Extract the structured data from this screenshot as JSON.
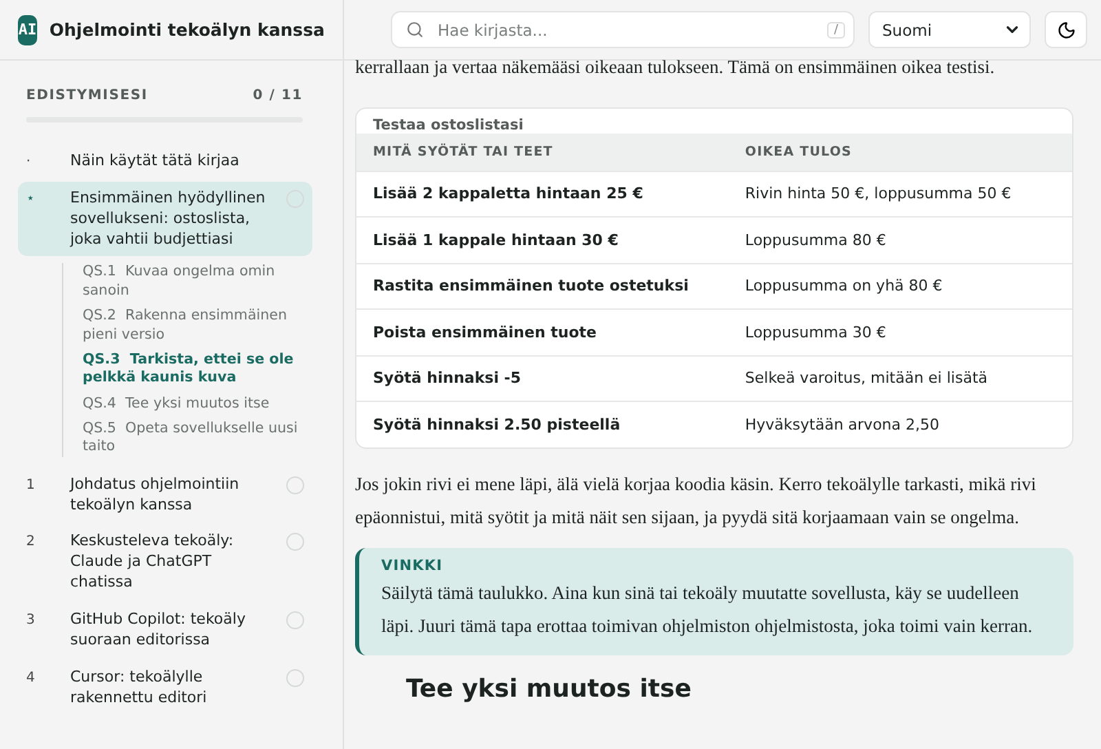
{
  "brand": {
    "logo": "AI",
    "title": "Ohjelmointi tekoälyn kanssa"
  },
  "progress": {
    "label": "EDISTYMISESI",
    "count": "0 / 11",
    "level": 0
  },
  "chapters": [
    {
      "marker": "·",
      "title": "Näin käytät tätä kirjaa",
      "selected": false
    },
    {
      "marker": "⋆",
      "title": "Ensimmäinen hyödyllinen sovellukseni: ostoslista, joka vahtii budjettiasi",
      "selected": true,
      "completed": false,
      "children": [
        {
          "number": "QS.1",
          "title": "Kuvaa ongelma omin sanoin",
          "selected": false
        },
        {
          "number": "QS.2",
          "title": "Rakenna ensimmäinen pieni versio",
          "selected": false
        },
        {
          "number": "QS.3",
          "title": "Tarkista, ettei se ole pelkkä kaunis kuva",
          "selected": true
        },
        {
          "number": "QS.4",
          "title": "Tee yksi muutos itse",
          "selected": false
        },
        {
          "number": "QS.5",
          "title": "Opeta sovellukselle uusi taito",
          "selected": false
        }
      ]
    },
    {
      "marker": "1",
      "title": "Johdatus ohjelmointiin tekoälyn kanssa",
      "selected": false,
      "completed": false
    },
    {
      "marker": "2",
      "title": "Keskusteleva tekoäly: Claude ja ChatGPT chatissa",
      "selected": false,
      "completed": false
    },
    {
      "marker": "3",
      "title": "GitHub Copilot: tekoäly suoraan editorissa",
      "selected": false,
      "completed": false
    },
    {
      "marker": "4",
      "title": "Cursor: tekoälylle rakennettu editori",
      "selected": false,
      "completed": false
    }
  ],
  "search": {
    "placeholder": "Hae kirjasta...",
    "shortcut": "/"
  },
  "language": {
    "value": "Suomi"
  },
  "intro": "kerrallaan ja vertaa näkemääsi oikeaan tulokseen. Tämä on ensimmäinen oikea testisi.",
  "table": {
    "caption": "Testaa ostoslistasi",
    "columns": [
      "MITÄ SYÖTÄT TAI TEET",
      "OIKEA TULOS"
    ],
    "rows": [
      [
        "Lisää 2 kappaletta hintaan 25 €",
        "Rivin hinta 50 €, loppusumma 50 €"
      ],
      [
        "Lisää 1 kappale hintaan 30 €",
        "Loppusumma 80 €"
      ],
      [
        "Rastita ensimmäinen tuote ostetuksi",
        "Loppusumma on yhä 80 €"
      ],
      [
        "Poista ensimmäinen tuote",
        "Loppusumma 30 €"
      ],
      [
        "Syötä hinnaksi -5",
        "Selkeä varoitus, mitään ei lisätä"
      ],
      [
        "Syötä hinnaksi 2.50 pisteellä",
        "Hyväksytään arvona 2,50"
      ]
    ]
  },
  "paragraph": "Jos jokin rivi ei mene läpi, älä vielä korjaa koodia käsin. Kerro tekoälylle tarkasti, mikä rivi epäonnistui, mitä syötit ja mitä näit sen sijaan, ja pyydä sitä korjaamaan vain se ongelma.",
  "tip": {
    "label": "VINKKI",
    "text": "Säilytä tämä taulukko. Aina kun sinä tai tekoäly muutatte sovellusta, käy se uudelleen läpi. Juuri tämä tapa erottaa toimivan ohjelmiston ohjelmistosta, joka toimi vain kerran."
  },
  "heading": "Tee yksi muutos itse"
}
